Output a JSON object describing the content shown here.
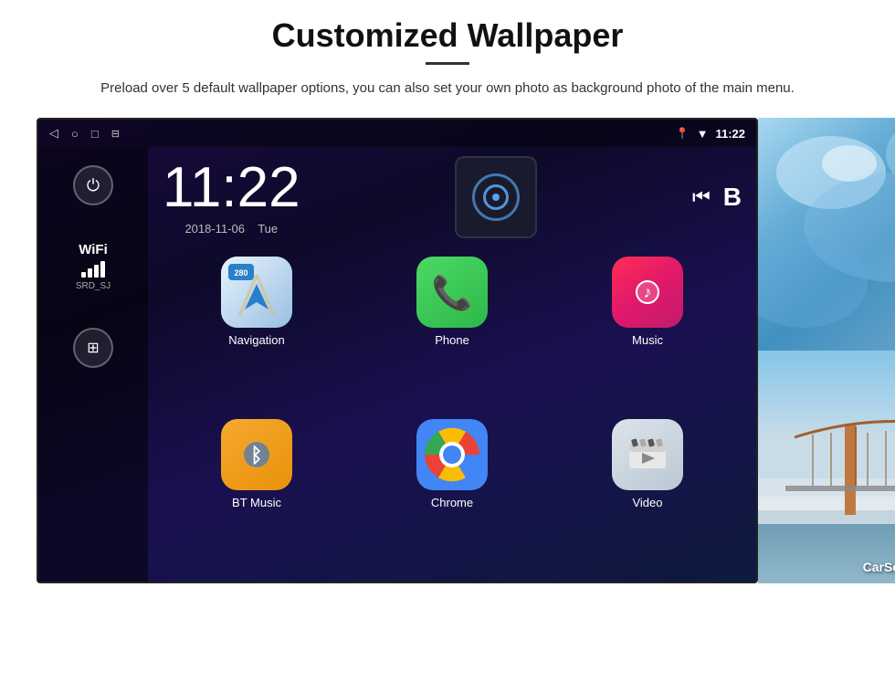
{
  "page": {
    "title": "Customized Wallpaper",
    "subtitle": "Preload over 5 default wallpaper options, you can also set your own photo as background photo of the main menu."
  },
  "device": {
    "status_bar": {
      "back_icon": "◁",
      "home_icon": "○",
      "recents_icon": "□",
      "screenshot_icon": "⊟",
      "location_icon": "♦",
      "wifi_icon": "▼",
      "time": "11:22"
    },
    "clock": {
      "time": "11:22",
      "date": "2018-11-06",
      "day": "Tue"
    },
    "sidebar": {
      "wifi_label": "WiFi",
      "wifi_ssid": "SRD_SJ"
    },
    "apps": [
      {
        "id": "navigation",
        "label": "Navigation",
        "badge": "280"
      },
      {
        "id": "phone",
        "label": "Phone"
      },
      {
        "id": "music",
        "label": "Music"
      },
      {
        "id": "btmusic",
        "label": "BT Music"
      },
      {
        "id": "chrome",
        "label": "Chrome"
      },
      {
        "id": "video",
        "label": "Video"
      }
    ]
  },
  "wallpapers": [
    {
      "id": "ice",
      "label": ""
    },
    {
      "id": "bridge",
      "label": "CarSetting"
    }
  ],
  "icons": {
    "power": "⏻",
    "grid": "⊞"
  }
}
